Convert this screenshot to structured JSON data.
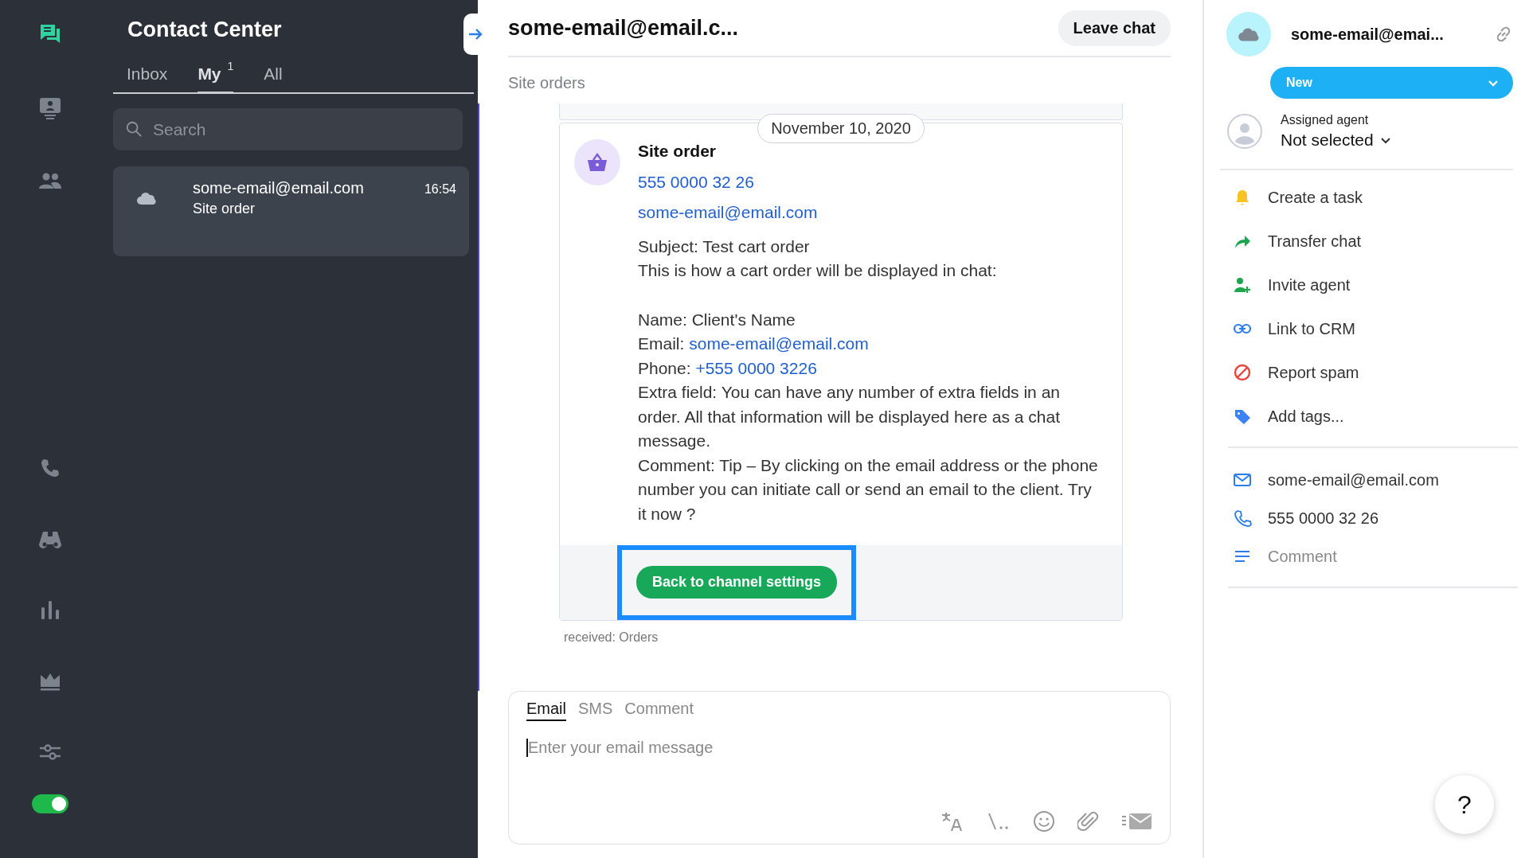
{
  "nav": {
    "items": [
      {
        "selected": true
      },
      {
        "selected": false
      },
      {
        "selected": false
      },
      {
        "selected": false
      },
      {
        "selected": false
      },
      {
        "selected": false
      },
      {
        "selected": false
      },
      {
        "selected": false
      }
    ],
    "online_toggle": {
      "on": true
    }
  },
  "list_panel": {
    "title": "Contact Center",
    "tabs": [
      {
        "label": "Inbox",
        "selected": false
      },
      {
        "label": "My",
        "badge": "1",
        "selected": true
      },
      {
        "label": "All",
        "selected": false
      }
    ],
    "search": {
      "placeholder": "Search"
    },
    "conversations": [
      {
        "name": "some-email@email.com",
        "time": "16:54",
        "preview": "Site order",
        "selected": true
      }
    ]
  },
  "chat": {
    "title": "some-email@email.c...",
    "leave_button": "Leave chat",
    "subtitle": "Site orders",
    "date": "November 10, 2020",
    "message": {
      "title": "Site order",
      "phone": "555 0000 32 26",
      "email": "some-email@email.com",
      "intro": [
        {
          "text": "Subject:  Test cart order"
        },
        {
          "text": "This is how a cart order will be displayed in chat:"
        }
      ],
      "fields": [
        {
          "text": "Name: Client's Name"
        },
        {
          "text": "Email:",
          "link": "some-email@email.com"
        },
        {
          "text": "Phone:",
          "link": "+555 0000 3226"
        },
        {
          "text": "Extra field: You can have any number of extra fields in an order. All that information will be displayed here as a chat message."
        },
        {
          "text": "Comment: Tip – By clicking on the email address or the phone number you can initiate call or send an email to the client. Try it now ?"
        }
      ],
      "button": {
        "label": "Back to channel settings",
        "highlighted": true
      }
    },
    "received": "received: Orders",
    "composer": {
      "tabs": [
        {
          "label": "Email",
          "selected": true
        },
        {
          "label": "SMS",
          "selected": false
        },
        {
          "label": "Comment",
          "selected": false
        }
      ],
      "placeholder": "Enter your email message"
    }
  },
  "details": {
    "name": "some-email@emai...",
    "status": {
      "label": "New"
    },
    "assigned": {
      "label": "Assigned agent",
      "value": "Not selected"
    },
    "actions": [
      {
        "kind": "task",
        "label": "Create a task"
      },
      {
        "kind": "transfer",
        "label": "Transfer chat"
      },
      {
        "kind": "invite",
        "label": "Invite agent"
      },
      {
        "kind": "crm",
        "label": "Link to CRM"
      },
      {
        "kind": "spam",
        "label": "Report spam"
      },
      {
        "kind": "tags",
        "label": "Add tags..."
      }
    ],
    "contacts": [
      {
        "kind": "email",
        "text": "some-email@email.com"
      },
      {
        "kind": "phone",
        "text": "555 0000 32 26"
      },
      {
        "kind": "comment",
        "text": "Comment"
      }
    ]
  },
  "help_button": "?"
}
